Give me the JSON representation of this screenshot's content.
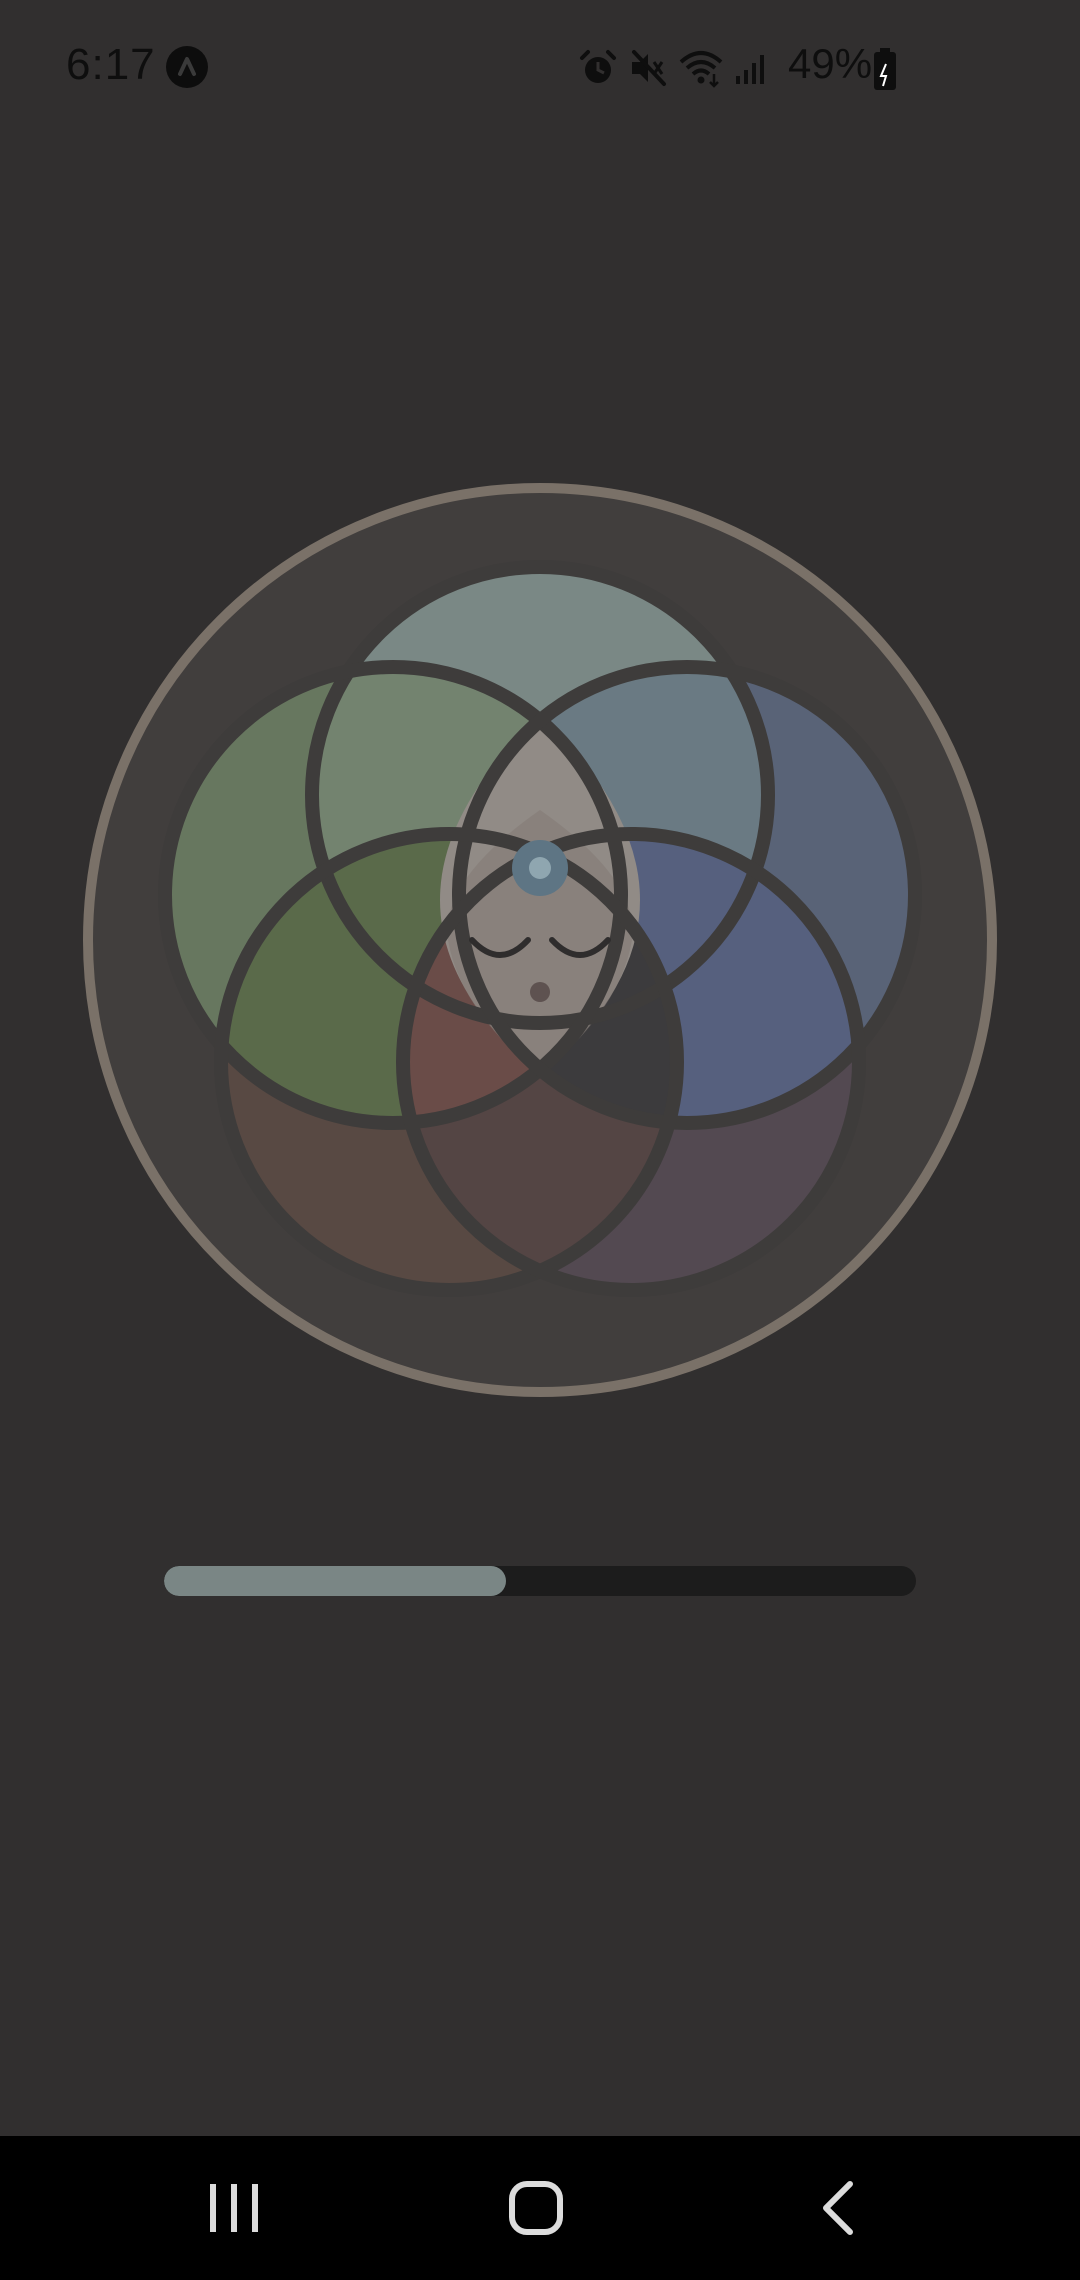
{
  "status_bar": {
    "time": "6:17",
    "battery_text": "49%",
    "icons": [
      "alarm-icon",
      "vibrate-mute-icon",
      "wifi-icon",
      "signal-icon",
      "battery-icon"
    ]
  },
  "progress": {
    "fraction": 0.455
  },
  "colors": {
    "background": "#312f2f",
    "progress_fill": "#7a8685",
    "progress_track": "#1c1c1c",
    "ring": "#7a7168"
  },
  "nav_bar": {
    "buttons": [
      "recents-button",
      "home-button",
      "back-button"
    ]
  }
}
